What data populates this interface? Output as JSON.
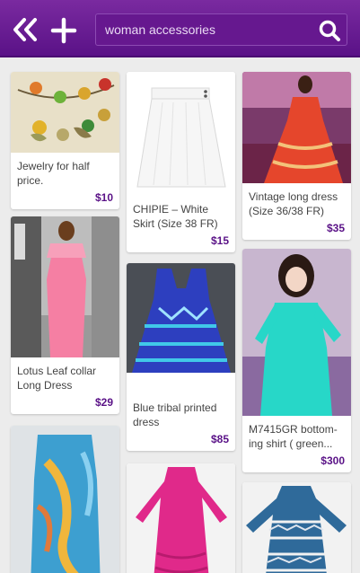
{
  "header": {
    "back_icon": "double-chevron-left-icon",
    "add_icon": "plus-icon",
    "search_icon": "magnifier-icon",
    "search_value": "woman accessories"
  },
  "colors": {
    "header": "#5a1287",
    "price": "#5a1287",
    "background": "#ececec"
  },
  "products": [
    {
      "title": "Jewelry for half price.",
      "price": "$10"
    },
    {
      "title": "CHIPIE – White Skirt (Size 38 FR)",
      "price": "$15"
    },
    {
      "title": "Vintage long dress (Size 36/38 FR)",
      "price": "$35"
    },
    {
      "title": "Lotus Leaf collar Long Dress",
      "price": "$29"
    },
    {
      "title": "Blue tribal printed dress",
      "price": "$85"
    },
    {
      "title": "M7415GR bottom-ing shirt ( green...",
      "price": "$300"
    },
    {
      "title": "",
      "price": ""
    },
    {
      "title": "",
      "price": ""
    },
    {
      "title": "",
      "price": ""
    }
  ]
}
